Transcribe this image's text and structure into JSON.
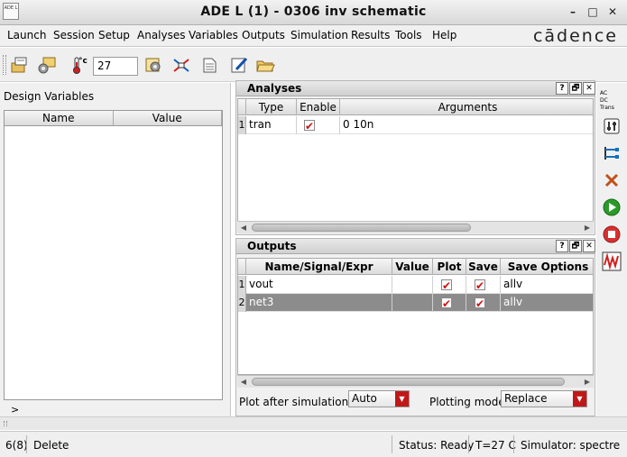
{
  "window": {
    "title": "ADE L (1) - 0306 inv schematic",
    "icon_label": "ADE L",
    "minimize": "–",
    "maximize": "□",
    "close": "✕"
  },
  "menu": {
    "items": [
      "Launch",
      "Session",
      "Setup",
      "Analyses",
      "Variables",
      "Outputs",
      "Simulation",
      "Results",
      "Tools",
      "Help"
    ],
    "brand": "cādence"
  },
  "toolbar": {
    "temperature_unit": "°c",
    "temperature_value": "27"
  },
  "design_variables": {
    "label": "Design Variables",
    "columns": [
      "Name",
      "Value"
    ],
    "expander": ">"
  },
  "analyses": {
    "title": "Analyses",
    "controls": [
      "?",
      "🗗",
      "✕"
    ],
    "columns": [
      "Type",
      "Enable",
      "Arguments"
    ],
    "rows": [
      {
        "index": "1",
        "type": "tran",
        "enabled": true,
        "arguments": "0 10n"
      }
    ]
  },
  "outputs": {
    "title": "Outputs",
    "controls": [
      "?",
      "🗗",
      "✕"
    ],
    "columns": [
      "Name/Signal/Expr",
      "Value",
      "Plot",
      "Save",
      "Save Options"
    ],
    "rows": [
      {
        "index": "1",
        "name": "vout",
        "value": "",
        "plot": true,
        "save": true,
        "save_options": "allv",
        "selected": false
      },
      {
        "index": "2",
        "name": "net3",
        "value": "",
        "plot": true,
        "save": true,
        "save_options": "allv",
        "selected": true
      }
    ],
    "plot_after_label": "Plot after simulation:",
    "plot_after_value": "Auto",
    "plotting_mode_label": "Plotting mode:",
    "plotting_mode_value": "Replace"
  },
  "sidebar": {
    "analysis_labels": [
      "AC",
      "DC",
      "Trans"
    ]
  },
  "status": {
    "count": "6(8)",
    "action": "Delete",
    "status": "Status: Ready",
    "temp": "T=27 C",
    "simulator": "Simulator: spectre"
  },
  "colors": {
    "check": "#d01010",
    "selected_row": "#8c8c8c",
    "combo_arrow": "#c01818",
    "run_green": "#2a9a2a",
    "stop_red": "#d83030"
  }
}
